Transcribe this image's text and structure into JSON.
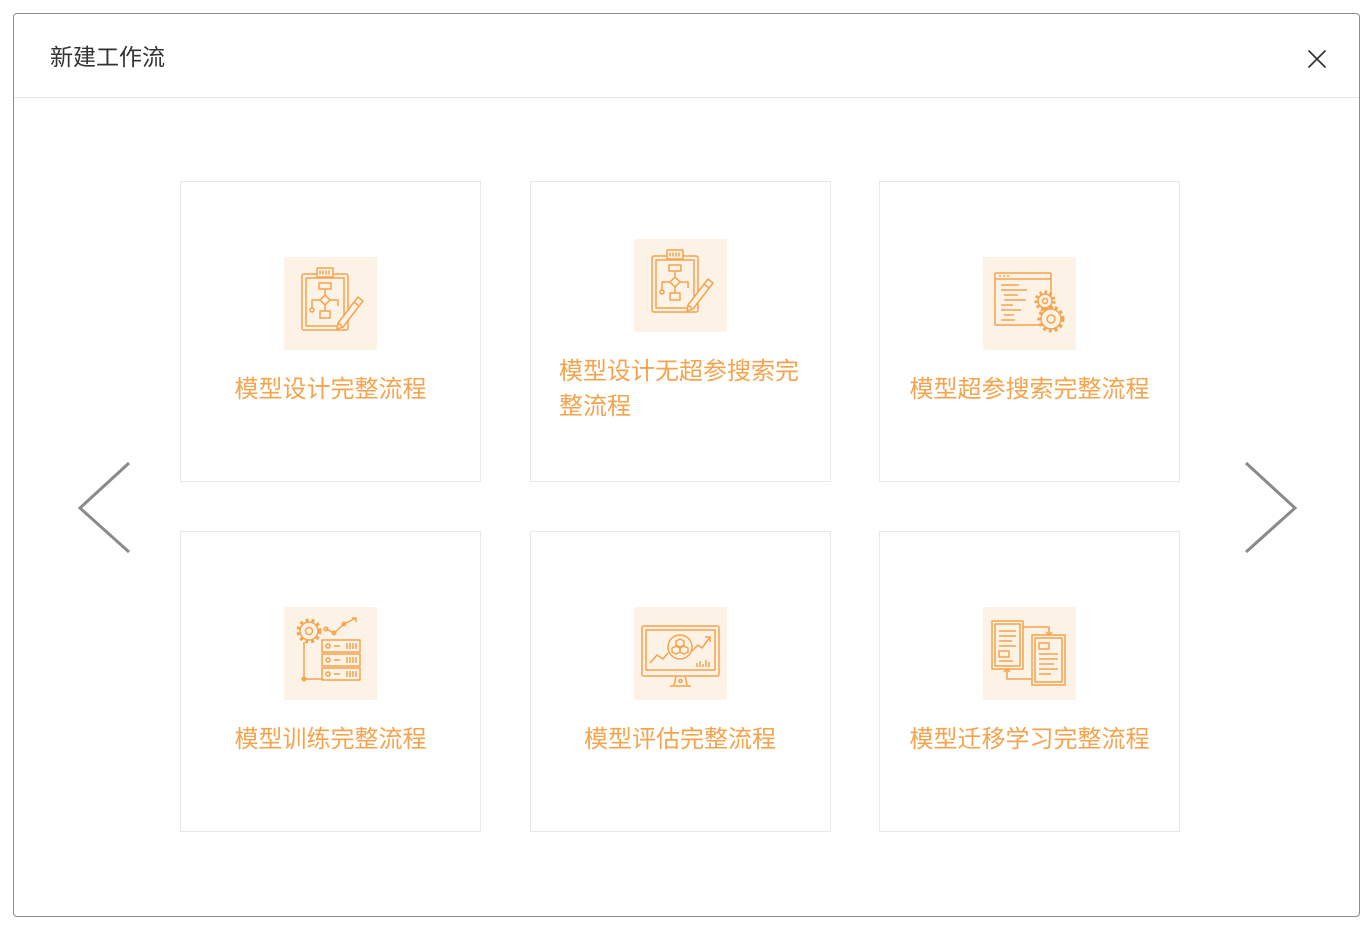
{
  "dialog": {
    "title": "新建工作流",
    "close_icon": "close-icon"
  },
  "carousel": {
    "prev_icon": "chevron-left-icon",
    "next_icon": "chevron-right-icon"
  },
  "workflows": [
    {
      "label": "模型设计完整流程",
      "icon": "flowchart-design-icon"
    },
    {
      "label": "模型设计无超参搜索完整流程",
      "icon": "flowchart-design-icon"
    },
    {
      "label": "模型超参搜索完整流程",
      "icon": "code-settings-icon"
    },
    {
      "label": "模型训练完整流程",
      "icon": "gear-server-icon"
    },
    {
      "label": "模型评估完整流程",
      "icon": "monitor-analytics-icon"
    },
    {
      "label": "模型迁移学习完整流程",
      "icon": "document-transfer-icon"
    }
  ],
  "colors": {
    "accent": "#f5a34d",
    "icon_background": "#fdf2e6",
    "title": "#333333",
    "card_border": "#e8e8e8",
    "dialog_border": "#8c8c8c",
    "arrow": "#8a8a8a"
  }
}
